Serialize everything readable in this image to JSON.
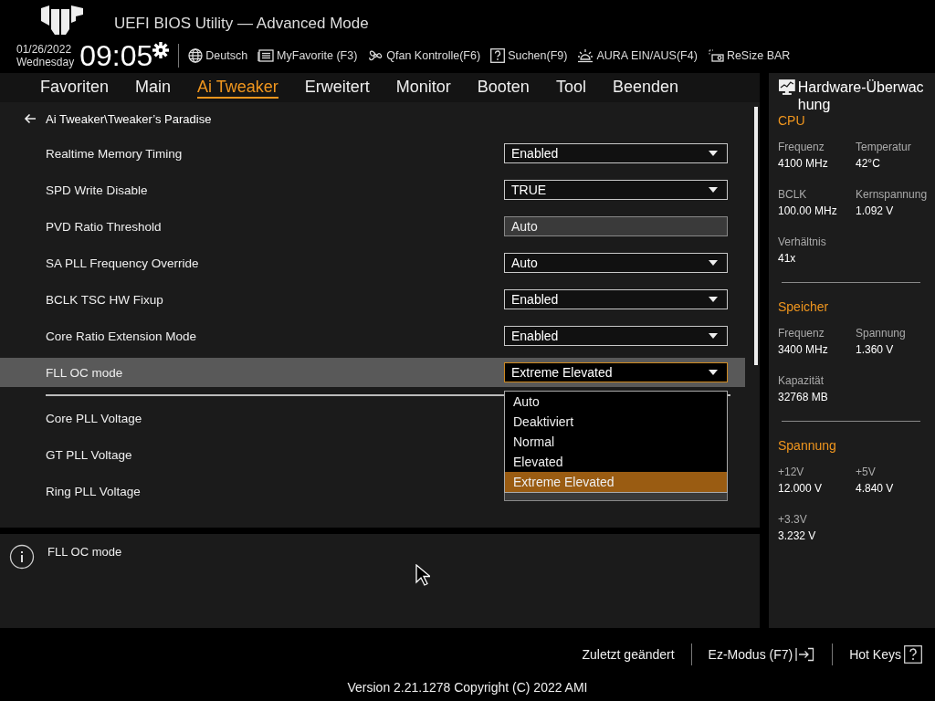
{
  "header": {
    "title": "UEFI BIOS Utility — Advanced Mode",
    "date": "01/26/2022",
    "weekday": "Wednesday",
    "time": "09:05",
    "toolbar": [
      {
        "kind": "language",
        "label": "Deutsch"
      },
      {
        "kind": "favorite",
        "label": "MyFavorite (F3)"
      },
      {
        "kind": "fan",
        "label": "Qfan Kontrolle(F6)"
      },
      {
        "kind": "search",
        "label": "Suchen(F9)"
      },
      {
        "kind": "aura",
        "label": "AURA EIN/AUS(F4)"
      },
      {
        "kind": "resize",
        "label": "ReSize BAR"
      }
    ]
  },
  "tabs": [
    {
      "label": "Favoriten",
      "selected": false
    },
    {
      "label": "Main",
      "selected": false
    },
    {
      "label": "Ai Tweaker",
      "selected": true
    },
    {
      "label": "Erweitert",
      "selected": false
    },
    {
      "label": "Monitor",
      "selected": false
    },
    {
      "label": "Booten",
      "selected": false
    },
    {
      "label": "Tool",
      "selected": false
    },
    {
      "label": "Beenden",
      "selected": false
    }
  ],
  "breadcrumb": "Ai Tweaker\\Tweaker’s Paradise",
  "settings": {
    "sections": [
      {
        "rows": [
          {
            "label": "Realtime Memory Timing",
            "value": "Enabled",
            "disabled": false,
            "selected": false
          },
          {
            "label": "SPD Write Disable",
            "value": "TRUE",
            "disabled": false,
            "selected": false
          },
          {
            "label": "PVD Ratio Threshold",
            "value": "Auto",
            "disabled": true,
            "selected": false
          },
          {
            "label": "SA PLL Frequency Override",
            "value": "Auto",
            "disabled": false,
            "selected": false
          },
          {
            "label": "BCLK TSC HW Fixup",
            "value": "Enabled",
            "disabled": false,
            "selected": false
          },
          {
            "label": "Core Ratio Extension Mode",
            "value": "Enabled",
            "disabled": false,
            "selected": false
          },
          {
            "label": "FLL OC mode",
            "value": "Extreme Elevated",
            "disabled": false,
            "selected": true
          }
        ]
      },
      {
        "rows": [
          {
            "label": "Core PLL Voltage",
            "selected": false
          },
          {
            "label": "GT PLL Voltage",
            "selected": false
          },
          {
            "label": "Ring PLL Voltage",
            "disabled": true,
            "selected": false
          }
        ]
      }
    ]
  },
  "dropdown": {
    "options": [
      {
        "label": "Auto",
        "selected": false
      },
      {
        "label": "Deaktiviert",
        "selected": false
      },
      {
        "label": "Normal",
        "selected": false
      },
      {
        "label": "Elevated",
        "selected": false
      },
      {
        "label": "Extreme Elevated",
        "selected": true
      }
    ]
  },
  "help": {
    "text": "FLL OC mode"
  },
  "hardware_monitor": {
    "title": "Hardware-Überwachung",
    "sections": [
      {
        "title": "CPU",
        "items": [
          {
            "label": "Frequenz",
            "value": "4100 MHz"
          },
          {
            "label": "Temperatur",
            "value": "42°C"
          },
          {
            "label": "BCLK",
            "value": "100.00 MHz"
          },
          {
            "label": "Kernspannung",
            "value": "1.092 V"
          },
          {
            "label": "Verhältnis",
            "value": "41x"
          }
        ]
      },
      {
        "title": "Speicher",
        "items": [
          {
            "label": "Frequenz",
            "value": "3400 MHz"
          },
          {
            "label": "Spannung",
            "value": "1.360 V"
          },
          {
            "label": "Kapazität",
            "value": "32768 MB"
          }
        ]
      },
      {
        "title": "Spannung",
        "items": [
          {
            "label": "+12V",
            "value": "12.000 V"
          },
          {
            "label": "+5V",
            "value": "4.840 V"
          },
          {
            "label": "+3.3V",
            "value": "3.232 V"
          }
        ]
      }
    ]
  },
  "footer": {
    "actions": [
      {
        "kind": "last-changed",
        "label": "Zuletzt geändert"
      },
      {
        "kind": "ez-mode",
        "label": "Ez-Modus (F7)"
      },
      {
        "kind": "hot-keys",
        "label": "Hot Keys"
      }
    ],
    "version": "Version 2.21.1278 Copyright (C) 2022 AMI"
  }
}
